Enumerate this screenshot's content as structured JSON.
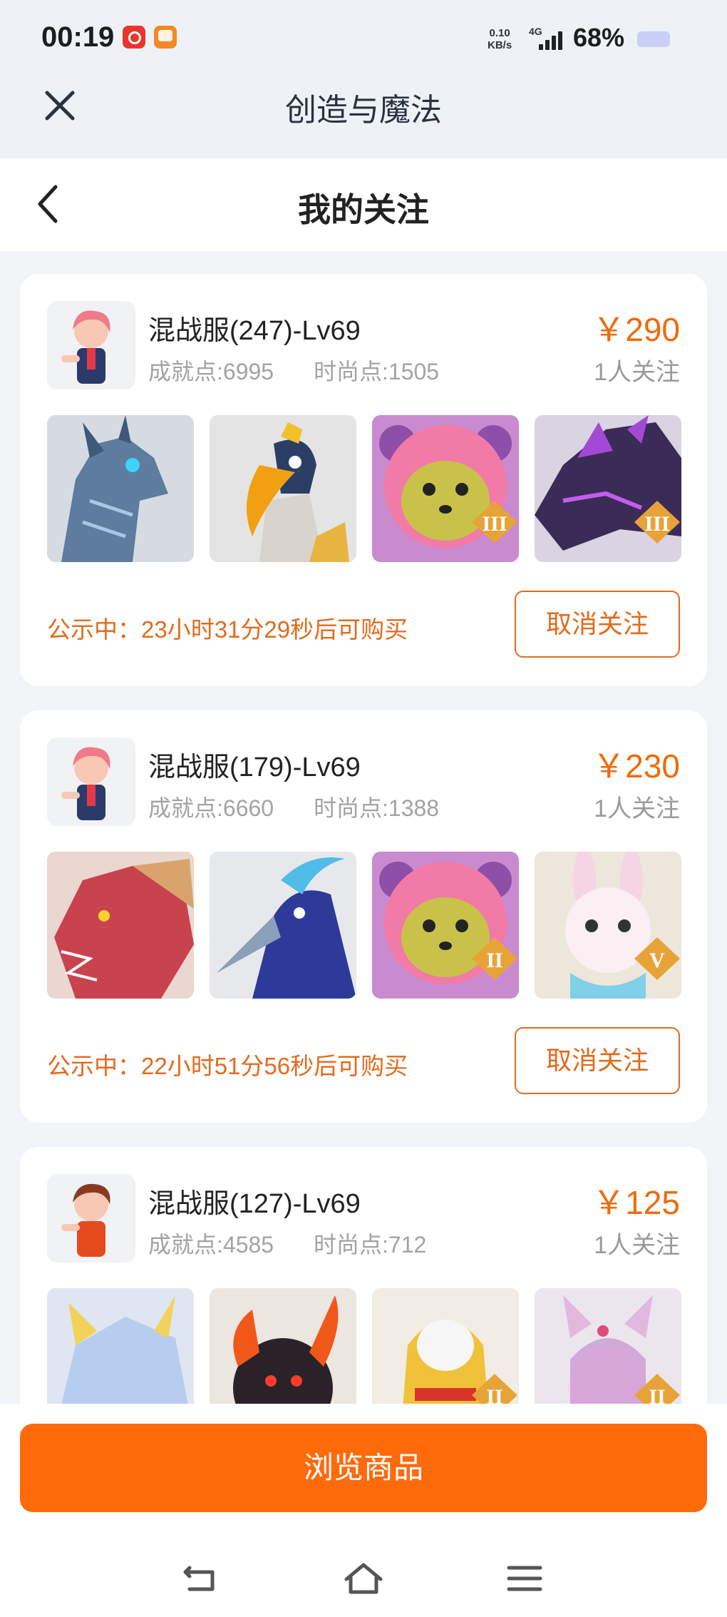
{
  "status_bar": {
    "time": "00:19",
    "net_speed_value": "0.10",
    "net_speed_unit": "KB/s",
    "network": "4G",
    "battery": "68%"
  },
  "app_bar": {
    "title": "创造与魔法",
    "close_icon": "close-icon"
  },
  "sub_header": {
    "title": "我的关注",
    "back_icon": "chevron-left-icon"
  },
  "listings": [
    {
      "server": "混战服(247)-Lv69",
      "achievement": "成就点:6995",
      "fashion": "时尚点:1505",
      "price": "￥290",
      "followers": "1人关注",
      "notice": "公示中：23小时31分29秒后可购买",
      "unfollow_label": "取消关注",
      "items": [
        {
          "name": "blue-dragon-mount",
          "badge": ""
        },
        {
          "name": "hornbill-pet",
          "badge": ""
        },
        {
          "name": "pink-bear-pet",
          "badge": "III"
        },
        {
          "name": "purple-dragon-mount",
          "badge": "III"
        }
      ]
    },
    {
      "server": "混战服(179)-Lv69",
      "achievement": "成就点:6660",
      "fashion": "时尚点:1388",
      "price": "￥230",
      "followers": "1人关注",
      "notice": "公示中：22小时51分56秒后可购买",
      "unfollow_label": "取消关注",
      "items": [
        {
          "name": "red-dragon-mount",
          "badge": ""
        },
        {
          "name": "peacock-pet",
          "badge": ""
        },
        {
          "name": "pink-bear-pet",
          "badge": "II"
        },
        {
          "name": "bunny-pet",
          "badge": "V"
        }
      ]
    },
    {
      "server": "混战服(127)-Lv69",
      "achievement": "成就点:4585",
      "fashion": "时尚点:712",
      "price": "￥125",
      "followers": "1人关注",
      "notice": "",
      "unfollow_label": "",
      "items": [
        {
          "name": "ice-dragon-mount",
          "badge": ""
        },
        {
          "name": "fire-dragon-pet",
          "badge": ""
        },
        {
          "name": "golden-helmet-pet",
          "badge": "II"
        },
        {
          "name": "fox-spirit-pet",
          "badge": "II"
        }
      ]
    }
  ],
  "bottom_button": {
    "label": "浏览商品"
  },
  "colors": {
    "accent": "#f06a0c",
    "button": "#ff6a0a",
    "notice": "#e36a1c"
  }
}
